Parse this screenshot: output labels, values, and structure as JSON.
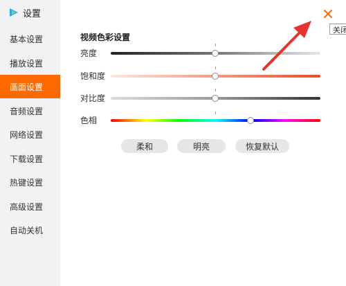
{
  "app": {
    "title": "设置"
  },
  "sidebar": {
    "items": [
      {
        "label": "基本设置"
      },
      {
        "label": "播放设置"
      },
      {
        "label": "画面设置",
        "active": true
      },
      {
        "label": "音频设置"
      },
      {
        "label": "网络设置"
      },
      {
        "label": "下载设置"
      },
      {
        "label": "热键设置"
      },
      {
        "label": "高级设置"
      },
      {
        "label": "自动关机"
      }
    ]
  },
  "main": {
    "section_title": "视频色彩设置",
    "sliders": [
      {
        "label": "亮度",
        "value": 0.5
      },
      {
        "label": "饱和度",
        "value": 0.5
      },
      {
        "label": "对比度",
        "value": 0.5
      },
      {
        "label": "色相",
        "value": 0.66
      }
    ],
    "buttons": [
      {
        "label": "柔和"
      },
      {
        "label": "明亮"
      },
      {
        "label": "恢复默认"
      }
    ]
  },
  "window": {
    "close_tooltip": "关闭"
  },
  "colors": {
    "accent": "#ff6a00",
    "annotation": "#e8322d"
  }
}
